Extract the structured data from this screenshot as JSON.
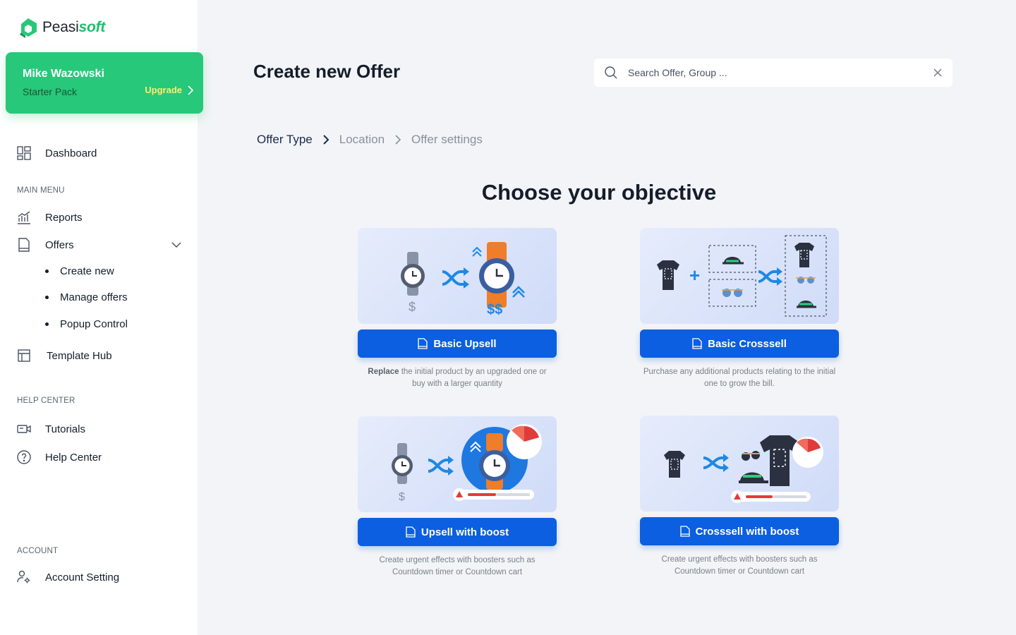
{
  "brand": {
    "name_plain": "Peasi",
    "name_accent": "soft"
  },
  "user": {
    "name": "Mike Wazowski",
    "plan": "Starter Pack",
    "upgrade_label": "Upgrade"
  },
  "nav": {
    "dashboard": "Dashboard",
    "main_menu_label": "MAIN MENU",
    "reports": "Reports",
    "offers": "Offers",
    "offers_sub": [
      "Create new",
      "Manage offers",
      "Popup Control"
    ],
    "template_hub": "Template Hub",
    "help_center_label": "HELP CENTER",
    "tutorials": "Tutorials",
    "help_center": "Help Center",
    "account_label": "ACCOUNT",
    "account_setting": "Account Setting"
  },
  "header": {
    "title": "Create new Offer",
    "search_placeholder": "Search Offer, Group ..."
  },
  "breadcrumb": [
    "Offer Type",
    "Location",
    "Offer settings"
  ],
  "heading": "Choose your objective",
  "cards": [
    {
      "button": "Basic Upsell",
      "desc_bold": "Replace",
      "desc": " the initial product by an upgraded one or buy with a larger quantity"
    },
    {
      "button": "Basic Crosssell",
      "desc_bold": "",
      "desc": "Purchase any additional products relating to the initial one to grow the bill."
    },
    {
      "button": "Upsell with boost",
      "desc_bold": "",
      "desc": "Create urgent effects with boosters such as Countdown timer or Countdown cart"
    },
    {
      "button": "Crosssell with boost",
      "desc_bold": "",
      "desc": "Create urgent effects with boosters such as Countdown timer or Countdown cart"
    }
  ],
  "colors": {
    "brand_green": "#27C879",
    "primary_blue": "#0B5FE0",
    "background": "#F2F4F7",
    "upgrade_yellow": "#F6F36B"
  }
}
